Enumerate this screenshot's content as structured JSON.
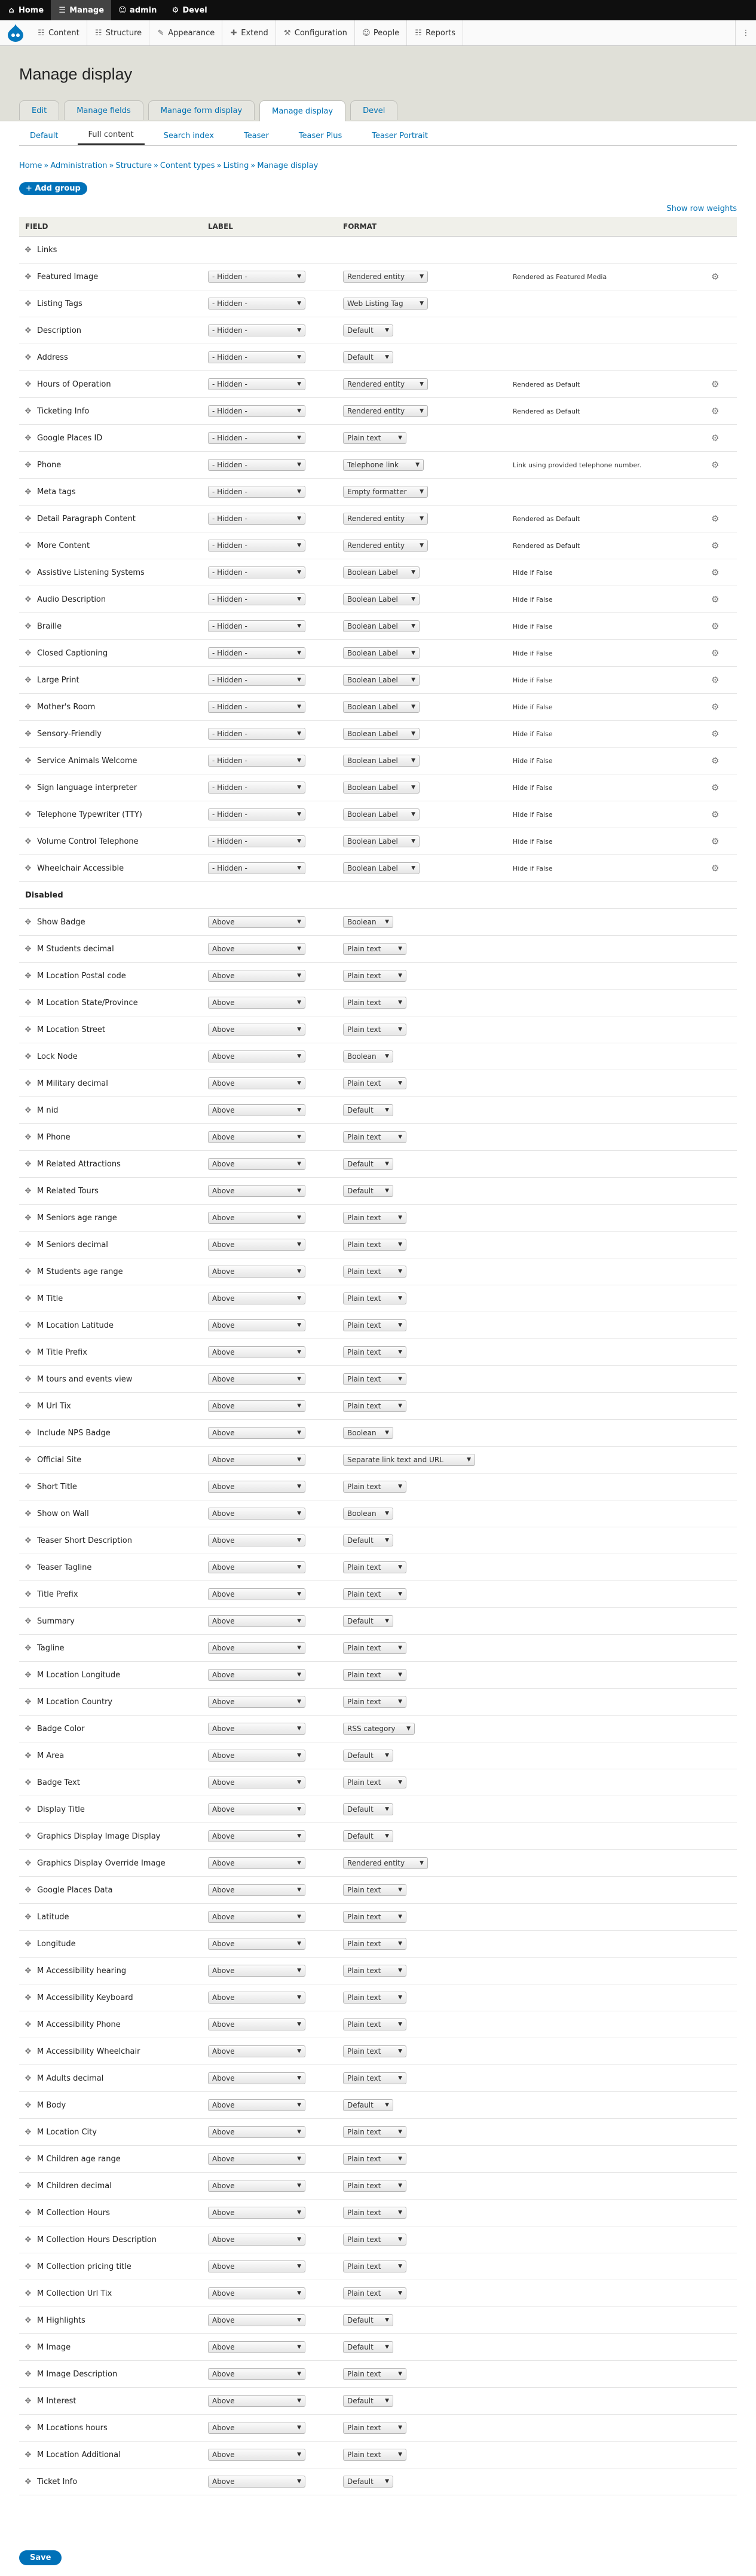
{
  "toolbar": {
    "items": [
      {
        "label": "Home",
        "icon": "home-icon"
      },
      {
        "label": "Manage",
        "icon": "menu-icon"
      },
      {
        "label": "admin",
        "icon": "user-icon"
      },
      {
        "label": "Devel",
        "icon": "gear-icon"
      }
    ]
  },
  "tray": {
    "items": [
      {
        "label": "Content",
        "icon": "content-icon"
      },
      {
        "label": "Structure",
        "icon": "structure-icon"
      },
      {
        "label": "Appearance",
        "icon": "appearance-icon"
      },
      {
        "label": "Extend",
        "icon": "extend-icon"
      },
      {
        "label": "Configuration",
        "icon": "wrench-icon"
      },
      {
        "label": "People",
        "icon": "people-icon"
      },
      {
        "label": "Reports",
        "icon": "reports-icon"
      }
    ]
  },
  "page": {
    "title": "Manage display",
    "tabs": [
      "Edit",
      "Manage fields",
      "Manage form display",
      "Manage display",
      "Devel"
    ],
    "active_tab": "Manage display",
    "subtabs": [
      "Default",
      "Full content",
      "Search index",
      "Teaser",
      "Teaser Plus",
      "Teaser Portrait"
    ],
    "active_subtab": "Full content",
    "breadcrumb": [
      "Home",
      "Administration",
      "Structure",
      "Content types",
      "Listing",
      "Manage display"
    ],
    "add_group": "+ Add group",
    "show_row_weights": "Show row weights",
    "save": "Save"
  },
  "table": {
    "headers": [
      "FIELD",
      "LABEL",
      "FORMAT"
    ],
    "enabled": [
      {
        "field": "Links",
        "label": "",
        "format": "",
        "summary": "",
        "gear": false
      },
      {
        "field": "Featured Image",
        "label": "- Hidden -",
        "format": "Rendered entity",
        "summary": "Rendered as Featured Media",
        "gear": true
      },
      {
        "field": "Listing Tags",
        "label": "- Hidden -",
        "format": "Web Listing Tag",
        "summary": "",
        "gear": false
      },
      {
        "field": "Description",
        "label": "- Hidden -",
        "format": "Default",
        "summary": "",
        "gear": false
      },
      {
        "field": "Address",
        "label": "- Hidden -",
        "format": "Default",
        "summary": "",
        "gear": false
      },
      {
        "field": "Hours of Operation",
        "label": "- Hidden -",
        "format": "Rendered entity",
        "summary": "Rendered as Default",
        "gear": true
      },
      {
        "field": "Ticketing Info",
        "label": "- Hidden -",
        "format": "Rendered entity",
        "summary": "Rendered as Default",
        "gear": true
      },
      {
        "field": "Google Places ID",
        "label": "- Hidden -",
        "format": "Plain text",
        "summary": "",
        "gear": true
      },
      {
        "field": "Phone",
        "label": "- Hidden -",
        "format": "Telephone link",
        "summary": "Link using provided telephone number.",
        "gear": true
      },
      {
        "field": "Meta tags",
        "label": "- Hidden -",
        "format": "Empty formatter",
        "summary": "",
        "gear": false
      },
      {
        "field": "Detail Paragraph Content",
        "label": "- Hidden -",
        "format": "Rendered entity",
        "summary": "Rendered as Default",
        "gear": true
      },
      {
        "field": "More Content",
        "label": "- Hidden -",
        "format": "Rendered entity",
        "summary": "Rendered as Default",
        "gear": true
      },
      {
        "field": "Assistive Listening Systems",
        "label": "- Hidden -",
        "format": "Boolean Label",
        "summary": "Hide if False",
        "gear": true
      },
      {
        "field": "Audio Description",
        "label": "- Hidden -",
        "format": "Boolean Label",
        "summary": "Hide if False",
        "gear": true
      },
      {
        "field": "Braille",
        "label": "- Hidden -",
        "format": "Boolean Label",
        "summary": "Hide if False",
        "gear": true
      },
      {
        "field": "Closed Captioning",
        "label": "- Hidden -",
        "format": "Boolean Label",
        "summary": "Hide if False",
        "gear": true
      },
      {
        "field": "Large Print",
        "label": "- Hidden -",
        "format": "Boolean Label",
        "summary": "Hide if False",
        "gear": true
      },
      {
        "field": "Mother's Room",
        "label": "- Hidden -",
        "format": "Boolean Label",
        "summary": "Hide if False",
        "gear": true
      },
      {
        "field": "Sensory-Friendly",
        "label": "- Hidden -",
        "format": "Boolean Label",
        "summary": "Hide if False",
        "gear": true
      },
      {
        "field": "Service Animals Welcome",
        "label": "- Hidden -",
        "format": "Boolean Label",
        "summary": "Hide if False",
        "gear": true
      },
      {
        "field": "Sign language interpreter",
        "label": "- Hidden -",
        "format": "Boolean Label",
        "summary": "Hide if False",
        "gear": true
      },
      {
        "field": "Telephone Typewriter (TTY)",
        "label": "- Hidden -",
        "format": "Boolean Label",
        "summary": "Hide if False",
        "gear": true
      },
      {
        "field": "Volume Control Telephone",
        "label": "- Hidden -",
        "format": "Boolean Label",
        "summary": "Hide if False",
        "gear": true
      },
      {
        "field": "Wheelchair Accessible",
        "label": "- Hidden -",
        "format": "Boolean Label",
        "summary": "Hide if False",
        "gear": true
      }
    ],
    "disabled_title": "Disabled",
    "disabled": [
      {
        "field": "Show Badge",
        "label": "Above",
        "format": "Boolean"
      },
      {
        "field": "M Students decimal",
        "label": "Above",
        "format": "Plain text"
      },
      {
        "field": "M Location Postal code",
        "label": "Above",
        "format": "Plain text"
      },
      {
        "field": "M Location State/Province",
        "label": "Above",
        "format": "Plain text"
      },
      {
        "field": "M Location Street",
        "label": "Above",
        "format": "Plain text"
      },
      {
        "field": "Lock Node",
        "label": "Above",
        "format": "Boolean"
      },
      {
        "field": "M Military decimal",
        "label": "Above",
        "format": "Plain text"
      },
      {
        "field": "M nid",
        "label": "Above",
        "format": "Default"
      },
      {
        "field": "M Phone",
        "label": "Above",
        "format": "Plain text"
      },
      {
        "field": "M Related Attractions",
        "label": "Above",
        "format": "Default"
      },
      {
        "field": "M Related Tours",
        "label": "Above",
        "format": "Default"
      },
      {
        "field": "M Seniors age range",
        "label": "Above",
        "format": "Plain text"
      },
      {
        "field": "M Seniors decimal",
        "label": "Above",
        "format": "Plain text"
      },
      {
        "field": "M Students age range",
        "label": "Above",
        "format": "Plain text"
      },
      {
        "field": "M Title",
        "label": "Above",
        "format": "Plain text"
      },
      {
        "field": "M Location Latitude",
        "label": "Above",
        "format": "Plain text"
      },
      {
        "field": "M Title Prefix",
        "label": "Above",
        "format": "Plain text"
      },
      {
        "field": "M tours and events view",
        "label": "Above",
        "format": "Plain text"
      },
      {
        "field": "M Url Tix",
        "label": "Above",
        "format": "Plain text"
      },
      {
        "field": "Include NPS Badge",
        "label": "Above",
        "format": "Boolean"
      },
      {
        "field": "Official Site",
        "label": "Above",
        "format": "Separate link text and URL"
      },
      {
        "field": "Short Title",
        "label": "Above",
        "format": "Plain text"
      },
      {
        "field": "Show on Wall",
        "label": "Above",
        "format": "Boolean"
      },
      {
        "field": "Teaser Short Description",
        "label": "Above",
        "format": "Default"
      },
      {
        "field": "Teaser Tagline",
        "label": "Above",
        "format": "Plain text"
      },
      {
        "field": "Title Prefix",
        "label": "Above",
        "format": "Plain text"
      },
      {
        "field": "Summary",
        "label": "Above",
        "format": "Default"
      },
      {
        "field": "Tagline",
        "label": "Above",
        "format": "Plain text"
      },
      {
        "field": "M Location Longitude",
        "label": "Above",
        "format": "Plain text"
      },
      {
        "field": "M Location Country",
        "label": "Above",
        "format": "Plain text"
      },
      {
        "field": "Badge Color",
        "label": "Above",
        "format": "RSS category"
      },
      {
        "field": "M Area",
        "label": "Above",
        "format": "Default"
      },
      {
        "field": "Badge Text",
        "label": "Above",
        "format": "Plain text"
      },
      {
        "field": "Display Title",
        "label": "Above",
        "format": "Default"
      },
      {
        "field": "Graphics Display Image Display",
        "label": "Above",
        "format": "Default"
      },
      {
        "field": "Graphics Display Override Image",
        "label": "Above",
        "format": "Rendered entity"
      },
      {
        "field": "Google Places Data",
        "label": "Above",
        "format": "Plain text"
      },
      {
        "field": "Latitude",
        "label": "Above",
        "format": "Plain text"
      },
      {
        "field": "Longitude",
        "label": "Above",
        "format": "Plain text"
      },
      {
        "field": "M Accessibility hearing",
        "label": "Above",
        "format": "Plain text"
      },
      {
        "field": "M Accessibility Keyboard",
        "label": "Above",
        "format": "Plain text"
      },
      {
        "field": "M Accessibility Phone",
        "label": "Above",
        "format": "Plain text"
      },
      {
        "field": "M Accessibility Wheelchair",
        "label": "Above",
        "format": "Plain text"
      },
      {
        "field": "M Adults decimal",
        "label": "Above",
        "format": "Plain text"
      },
      {
        "field": "M Body",
        "label": "Above",
        "format": "Default"
      },
      {
        "field": "M Location City",
        "label": "Above",
        "format": "Plain text"
      },
      {
        "field": "M Children age range",
        "label": "Above",
        "format": "Plain text"
      },
      {
        "field": "M Children decimal",
        "label": "Above",
        "format": "Plain text"
      },
      {
        "field": "M Collection Hours",
        "label": "Above",
        "format": "Plain text"
      },
      {
        "field": "M Collection Hours Description",
        "label": "Above",
        "format": "Plain text"
      },
      {
        "field": "M Collection pricing title",
        "label": "Above",
        "format": "Plain text"
      },
      {
        "field": "M Collection Url Tix",
        "label": "Above",
        "format": "Plain text"
      },
      {
        "field": "M Highlights",
        "label": "Above",
        "format": "Default"
      },
      {
        "field": "M Image",
        "label": "Above",
        "format": "Default"
      },
      {
        "field": "M Image Description",
        "label": "Above",
        "format": "Plain text"
      },
      {
        "field": "M Interest",
        "label": "Above",
        "format": "Default"
      },
      {
        "field": "M Locations hours",
        "label": "Above",
        "format": "Plain text"
      },
      {
        "field": "M Location Additional",
        "label": "Above",
        "format": "Plain text"
      },
      {
        "field": "Ticket Info",
        "label": "Above",
        "format": "Default"
      }
    ]
  }
}
